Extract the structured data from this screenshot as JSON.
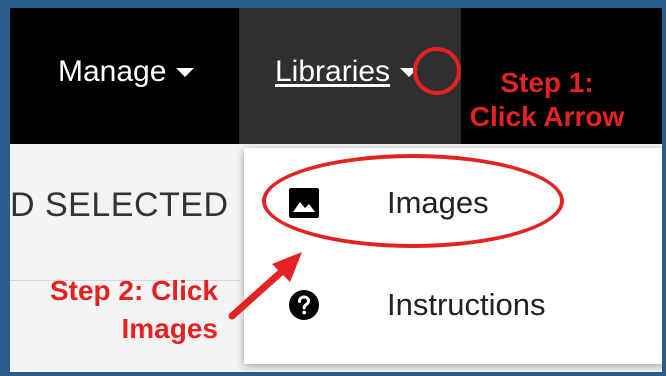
{
  "nav": {
    "manage_label": "Manage",
    "libraries_label": "Libraries"
  },
  "background_text": "D SELECTED",
  "dropdown": {
    "items": [
      {
        "label": "Images",
        "icon": "image-icon"
      },
      {
        "label": "Instructions",
        "icon": "question-icon"
      }
    ]
  },
  "annotations": {
    "step1_line1": "Step 1:",
    "step1_line2": "Click Arrow",
    "step2_line1": "Step 2: Click",
    "step2_line2": "Images"
  },
  "colors": {
    "annotation_red": "#e52222",
    "topbar": "#000000",
    "active_nav_bg": "#2f2f2f",
    "outer_border": "#2b5d8c"
  }
}
